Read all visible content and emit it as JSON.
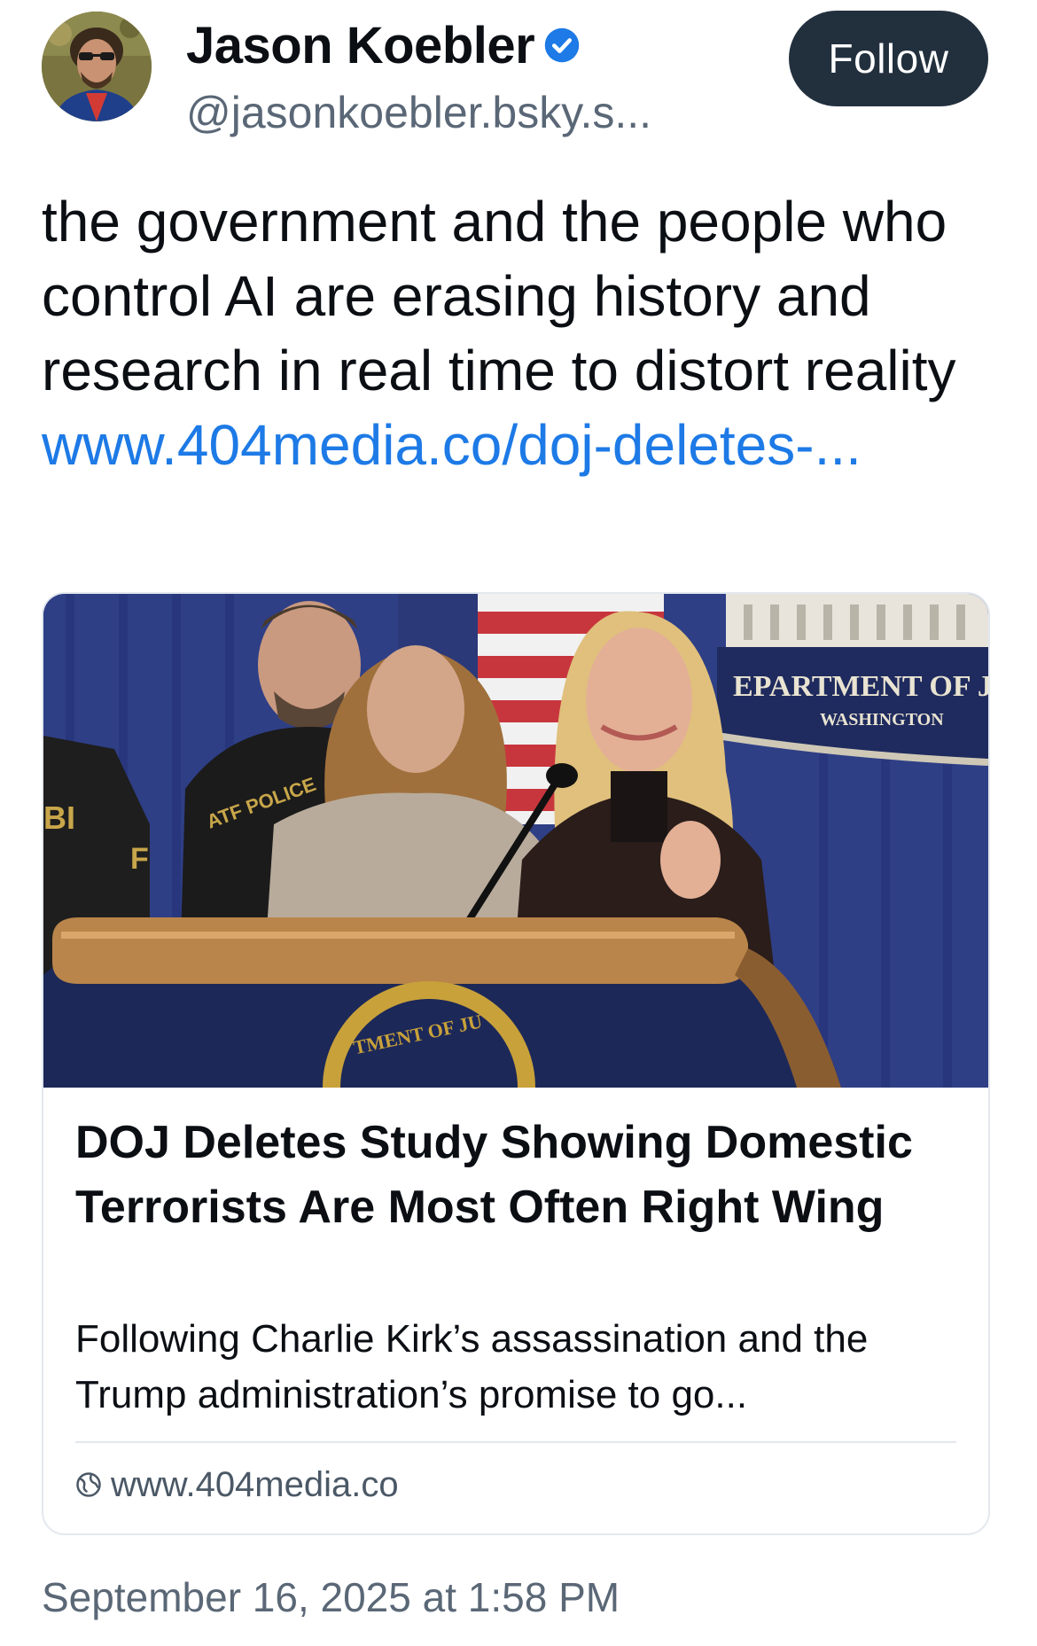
{
  "author": {
    "name": "Jason Koebler",
    "handle": "@jasonkoebler.bsky.s...",
    "verified": true
  },
  "follow_button": {
    "label": "Follow"
  },
  "post": {
    "text": "the government and the people who control AI are erasing history and research in real time to distort reality ",
    "link_text": "www.404media.co/doj-deletes-..."
  },
  "link_card": {
    "image_text_sign_top": "EPARTMENT OF JU",
    "image_text_sign_bottom": "WASHINGTON",
    "image_text_podium": "TMENT OF JU",
    "image_text_jacket": "ATF POLICE",
    "title": "DOJ Deletes Study Showing Domestic Terrorists Are Most Often Right Wing",
    "description": "Following Charlie Kirk’s assassination and the Trump administration’s promise to go...",
    "domain": "www.404media.co"
  },
  "timestamp": "September 16, 2025 at 1:58 PM",
  "colors": {
    "link": "#1d7ae6",
    "follow_button_bg": "#22303e",
    "verified_badge": "#1d7ae6",
    "muted_text": "#5a6776"
  },
  "icons": {
    "verified": "verified-check-icon",
    "globe": "globe-icon"
  }
}
